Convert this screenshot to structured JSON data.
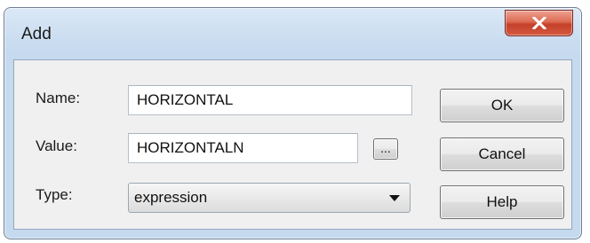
{
  "dialog": {
    "title": "Add",
    "close_icon": "close-x-icon"
  },
  "form": {
    "name_label": "Name:",
    "name_value": "HORIZONTAL",
    "value_label": "Value:",
    "value_value": "HORIZONTALN",
    "browse_label": "...",
    "type_label": "Type:",
    "type_selected": "expression"
  },
  "buttons": {
    "ok": "OK",
    "cancel": "Cancel",
    "help": "Help"
  },
  "colors": {
    "close_button": "#d55a3f",
    "title_bar": "#c9dcf0",
    "client_area": "#f0f0f0"
  }
}
